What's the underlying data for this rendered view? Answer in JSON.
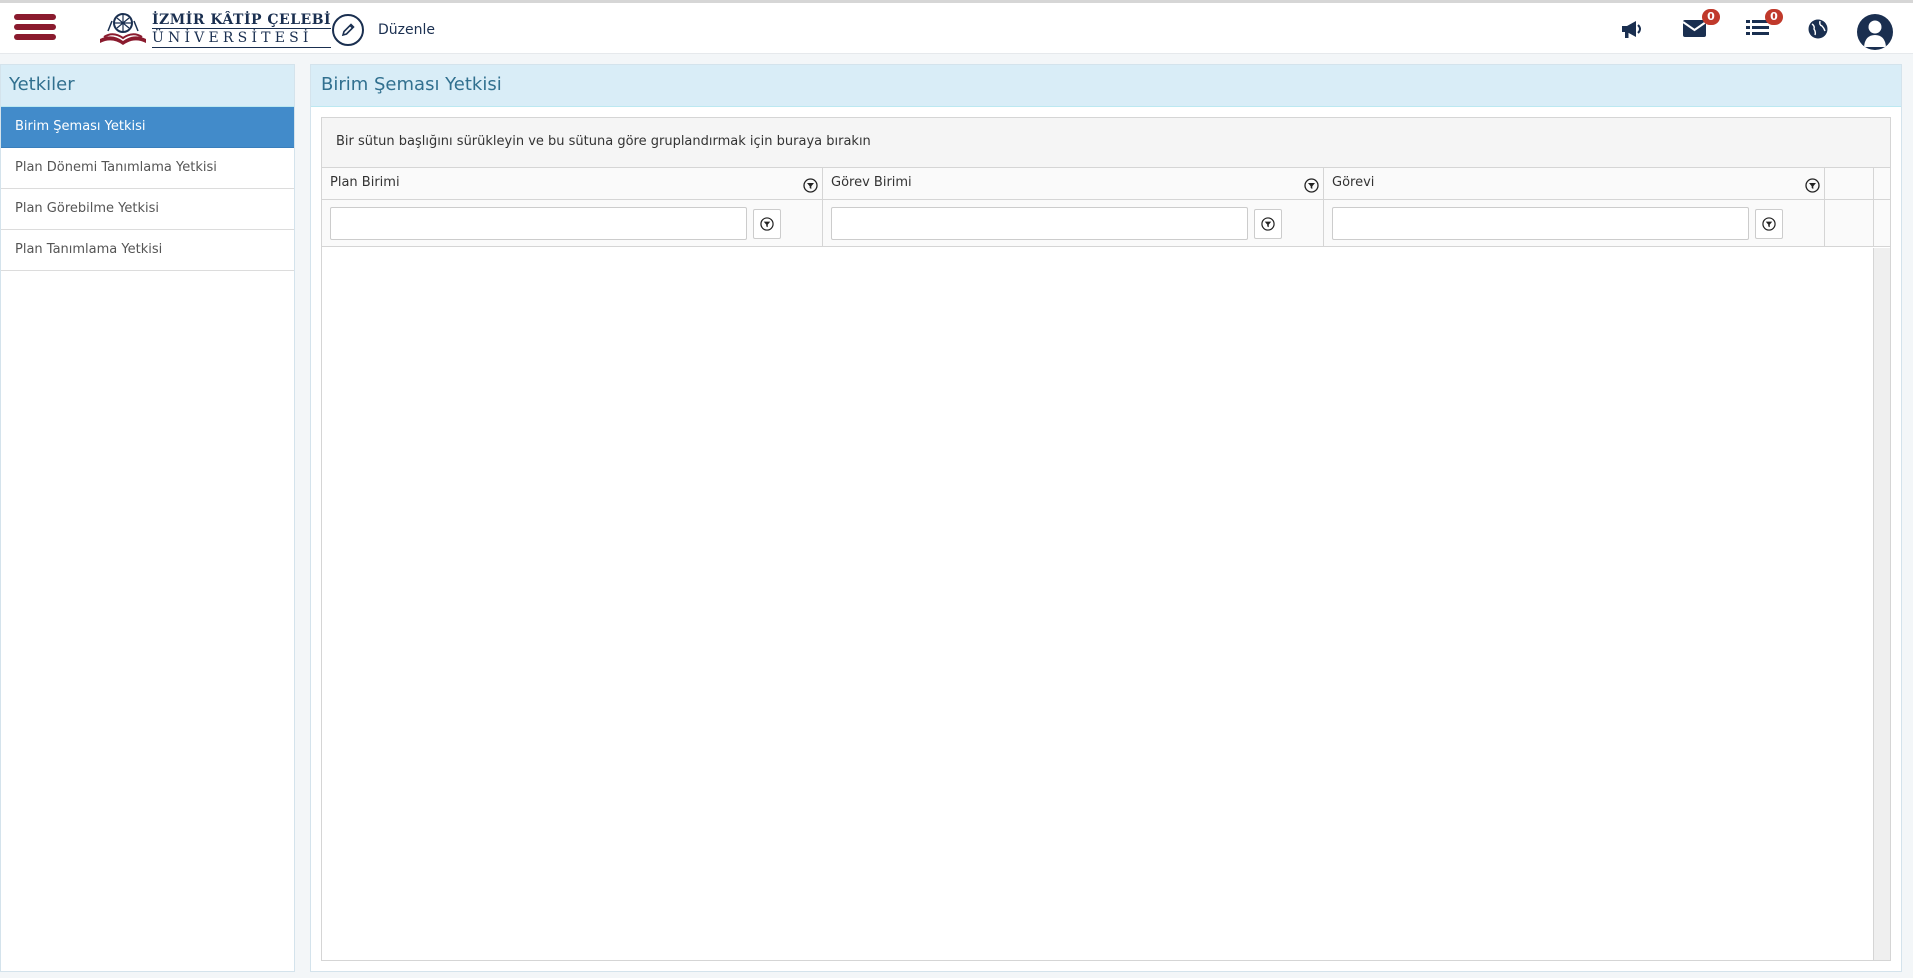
{
  "header": {
    "logo": {
      "line1": "İZMİR KÂTİP ÇELEBİ",
      "line2": "ÜNİVERSİTESİ"
    },
    "edit_label": "Düzenle",
    "icons": [
      {
        "name": "megaphone-icon"
      },
      {
        "name": "envelope-icon",
        "badge": "0"
      },
      {
        "name": "list-icon",
        "badge": "0"
      },
      {
        "name": "globe-icon"
      },
      {
        "name": "user-avatar-icon"
      }
    ],
    "messages_badge": "0",
    "tasks_badge": "0",
    "colors": {
      "brand": "#8a1b2e",
      "navy": "#1a2f50",
      "badge": "#c0392b"
    }
  },
  "sidebar": {
    "title": "Yetkiler",
    "items": [
      {
        "label": "Birim Şeması Yetkisi",
        "active": true
      },
      {
        "label": "Plan Dönemi Tanımlama Yetkisi",
        "active": false
      },
      {
        "label": "Plan Görebilme Yetkisi",
        "active": false
      },
      {
        "label": "Plan Tanımlama Yetkisi",
        "active": false
      }
    ],
    "colors": {
      "heading_bg": "#d9edf7",
      "heading_text": "#31708f",
      "active_bg": "#428bca"
    }
  },
  "main": {
    "title": "Birim Şeması Yetkisi",
    "grid": {
      "group_hint": "Bir sütun başlığını sürükleyin ve bu sütuna göre gruplandırmak için buraya bırakın",
      "columns": [
        {
          "label": "Plan Birimi",
          "filter_value": ""
        },
        {
          "label": "Görev Birimi",
          "filter_value": ""
        },
        {
          "label": "Görevi",
          "filter_value": ""
        }
      ],
      "rows": []
    }
  }
}
